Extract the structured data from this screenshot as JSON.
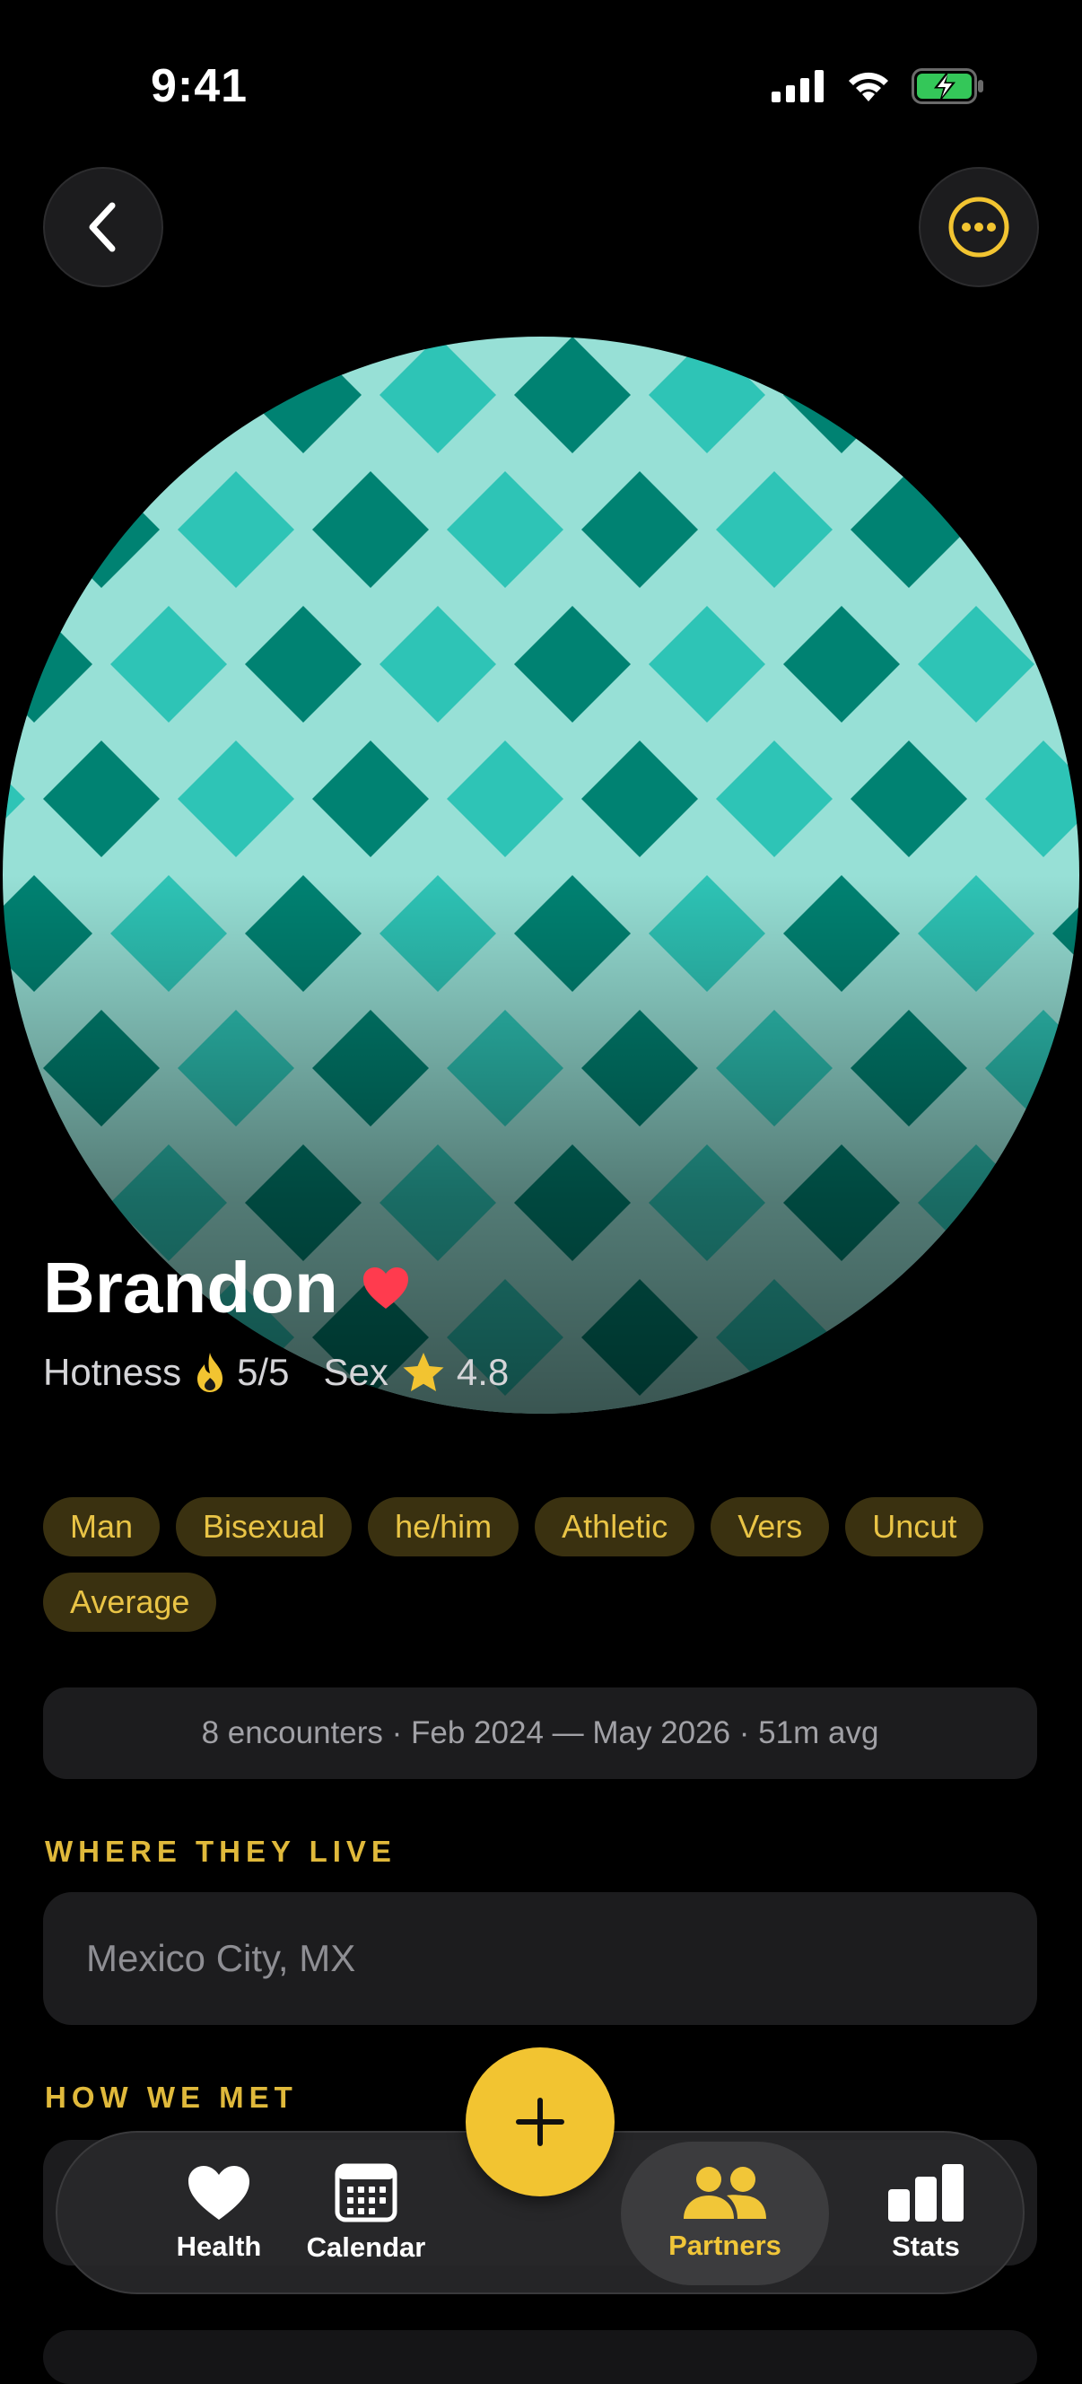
{
  "status_bar": {
    "time": "9:41"
  },
  "profile": {
    "name": "Brandon",
    "hotness_label": "Hotness",
    "hotness_value": "5/5",
    "sex_label": "Sex",
    "sex_value": "4.8",
    "favorite": true
  },
  "tags": [
    "Man",
    "Bisexual",
    "he/him",
    "Athletic",
    "Vers",
    "Uncut",
    "Average"
  ],
  "summary": "8 encounters · Feb 2024 — May 2026 · 51m avg",
  "where_they_live": {
    "label": "WHERE THEY LIVE",
    "value": "Mexico City, MX"
  },
  "how_we_met": {
    "label": "HOW WE MET"
  },
  "tab_bar": {
    "items": [
      {
        "label": "Health",
        "icon": "heart-icon"
      },
      {
        "label": "Calendar",
        "icon": "calendar-icon"
      },
      {
        "label": "Partners",
        "icon": "people-icon",
        "active": true
      },
      {
        "label": "Stats",
        "icon": "bar-chart-icon"
      }
    ],
    "add_icon": "plus-icon"
  },
  "colors": {
    "accent": "#F2C431",
    "tag_bg": "#3A3110",
    "tag_text": "#E9C446",
    "heart": "#FF3B4E",
    "card_bg": "#1C1C1E",
    "avatar_light": "#97E0D6",
    "avatar_mid": "#2EC4B6",
    "avatar_dark": "#008272"
  }
}
